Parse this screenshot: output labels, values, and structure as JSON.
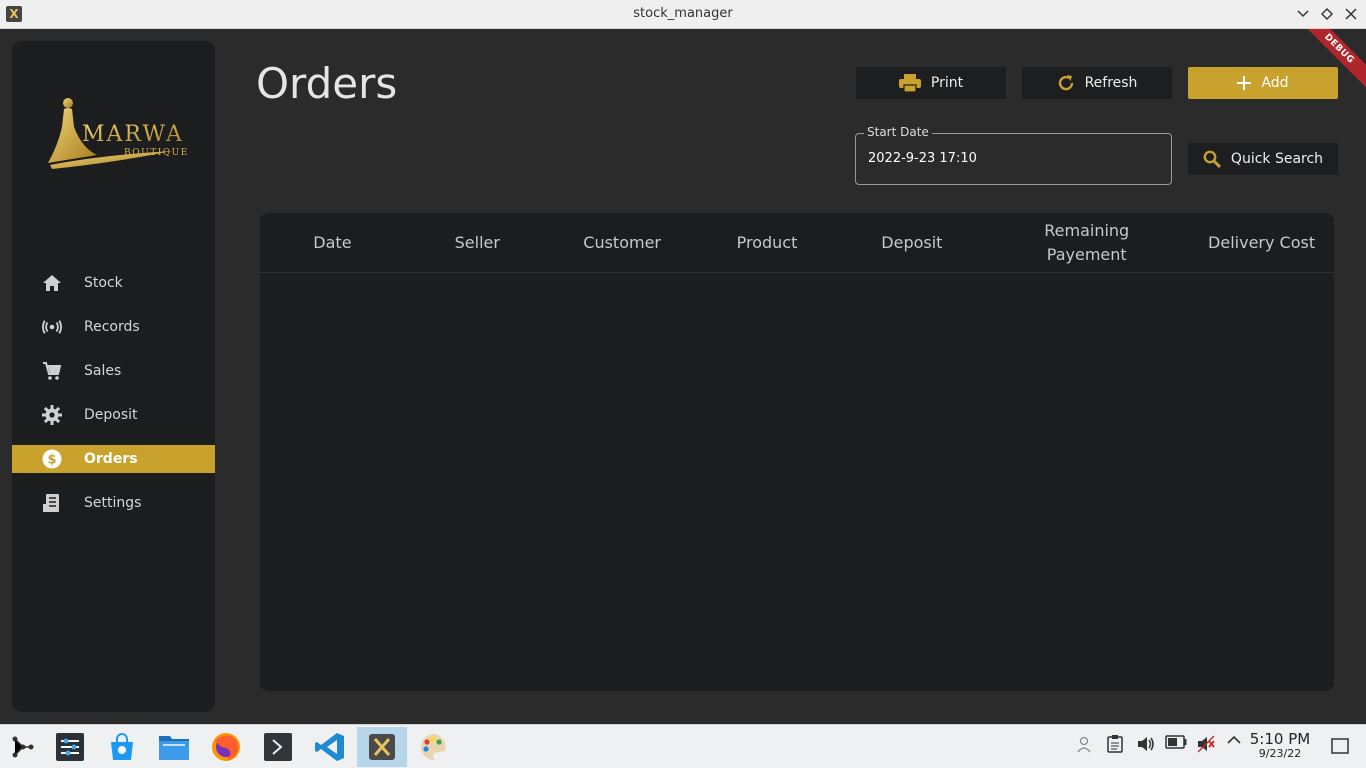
{
  "window": {
    "title": "stock_manager"
  },
  "debug_banner": "DEBUG",
  "logo": {
    "name": "MARWA",
    "tagline": "BOUTIQUE"
  },
  "sidebar": {
    "items": [
      {
        "label": "Stock",
        "icon": "home-icon"
      },
      {
        "label": "Records",
        "icon": "broadcast-icon"
      },
      {
        "label": "Sales",
        "icon": "cart-icon"
      },
      {
        "label": "Deposit",
        "icon": "gear-icon"
      },
      {
        "label": "Orders",
        "icon": "dollar-circle-icon",
        "active": true
      },
      {
        "label": "Settings",
        "icon": "receipt-icon"
      }
    ]
  },
  "page": {
    "title": "Orders",
    "buttons": {
      "print": "Print",
      "refresh": "Refresh",
      "add": "Add",
      "quick_search": "Quick Search"
    },
    "start_date": {
      "label": "Start Date",
      "value": "2022-9-23 17:10"
    }
  },
  "table": {
    "columns": [
      "Date",
      "Seller",
      "Customer",
      "Product",
      "Deposit",
      "Remaining Payement",
      "Delivery Cost"
    ],
    "rows": []
  },
  "colors": {
    "accent": "#c9a22e",
    "background": "#2b2b2b",
    "panel": "#1b1d1e"
  },
  "taskbar": {
    "apps": [
      "app-launcher-icon",
      "system-settings-icon",
      "discover-store-icon",
      "file-manager-icon",
      "firefox-icon",
      "terminal-icon",
      "vscode-icon",
      "stock-manager-icon",
      "paint-icon"
    ],
    "clock": {
      "time": "5:10 PM",
      "date": "9/23/22"
    }
  }
}
